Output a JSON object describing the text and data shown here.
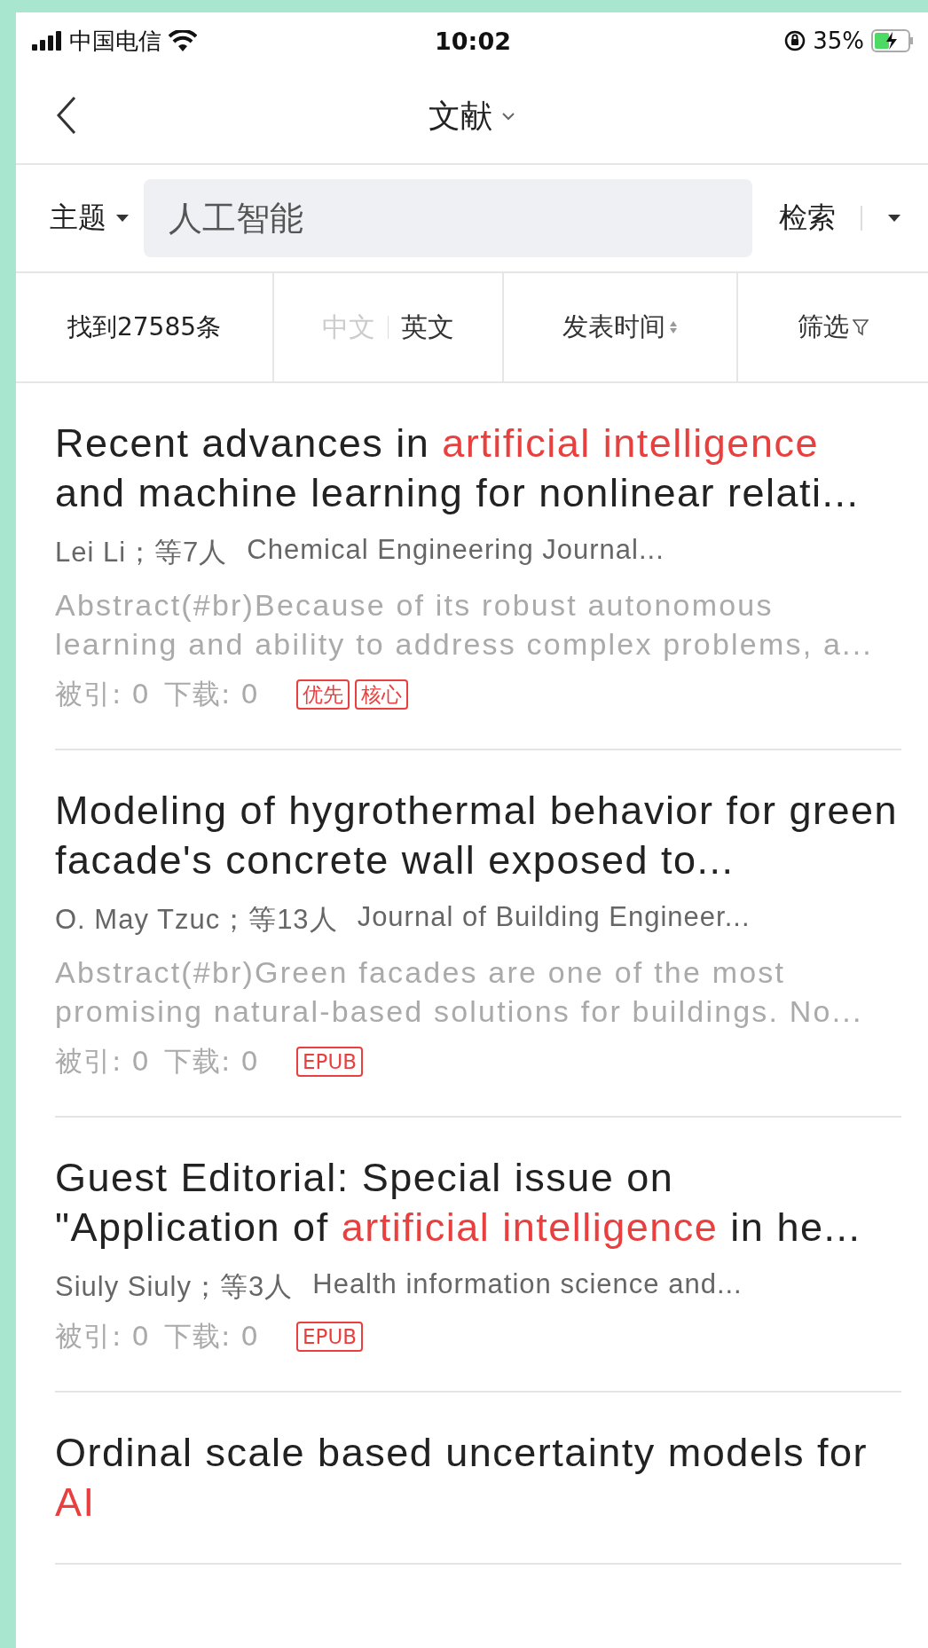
{
  "status_bar": {
    "carrier": "中国电信",
    "time": "10:02",
    "battery_percent": "35%"
  },
  "nav": {
    "title": "文献"
  },
  "search": {
    "field_type": "主题",
    "value": "人工智能",
    "button": "检索"
  },
  "filters": {
    "count": "找到27585条",
    "languages": [
      {
        "label": "中文",
        "selected": false
      },
      {
        "label": "英文",
        "selected": true
      }
    ],
    "sort": "发表时间",
    "filter": "筛选"
  },
  "results": [
    {
      "title": [
        {
          "text": "Recent advances in ",
          "highlight": false
        },
        {
          "text": "artificial intelligence",
          "highlight": true
        },
        {
          "text": " and machine learning for nonlinear relati...",
          "highlight": false
        }
      ],
      "authors": "Lei Li；等7人",
      "journal": "Chemical Engineering Journal...",
      "abstract": "Abstract(#br)Because of its robust autonomous learning and ability to address complex problems, a...",
      "cited": "被引: 0",
      "downloads": "下载: 0",
      "tags": [
        "优先",
        "核心"
      ]
    },
    {
      "title": [
        {
          "text": "Modeling of hygrothermal behavior for green facade's concrete wall exposed to...",
          "highlight": false
        }
      ],
      "authors": "O. May Tzuc；等13人",
      "journal": "Journal of Building Engineer...",
      "abstract": "Abstract(#br)Green facades are one of the most promising natural-based solutions for buildings. No...",
      "cited": "被引: 0",
      "downloads": "下载: 0",
      "tags": [
        "EPUB"
      ]
    },
    {
      "title": [
        {
          "text": "Guest Editorial: Special issue on \"Application of ",
          "highlight": false
        },
        {
          "text": "artificial intelligence",
          "highlight": true
        },
        {
          "text": " in he...",
          "highlight": false
        }
      ],
      "authors": "Siuly Siuly；等3人",
      "journal": "Health information science and...",
      "cited": "被引: 0",
      "downloads": "下载: 0",
      "tags": [
        "EPUB"
      ]
    },
    {
      "title": [
        {
          "text": "Ordinal scale based uncertainty models for ",
          "highlight": false
        },
        {
          "text": "AI",
          "highlight": true
        }
      ]
    }
  ]
}
